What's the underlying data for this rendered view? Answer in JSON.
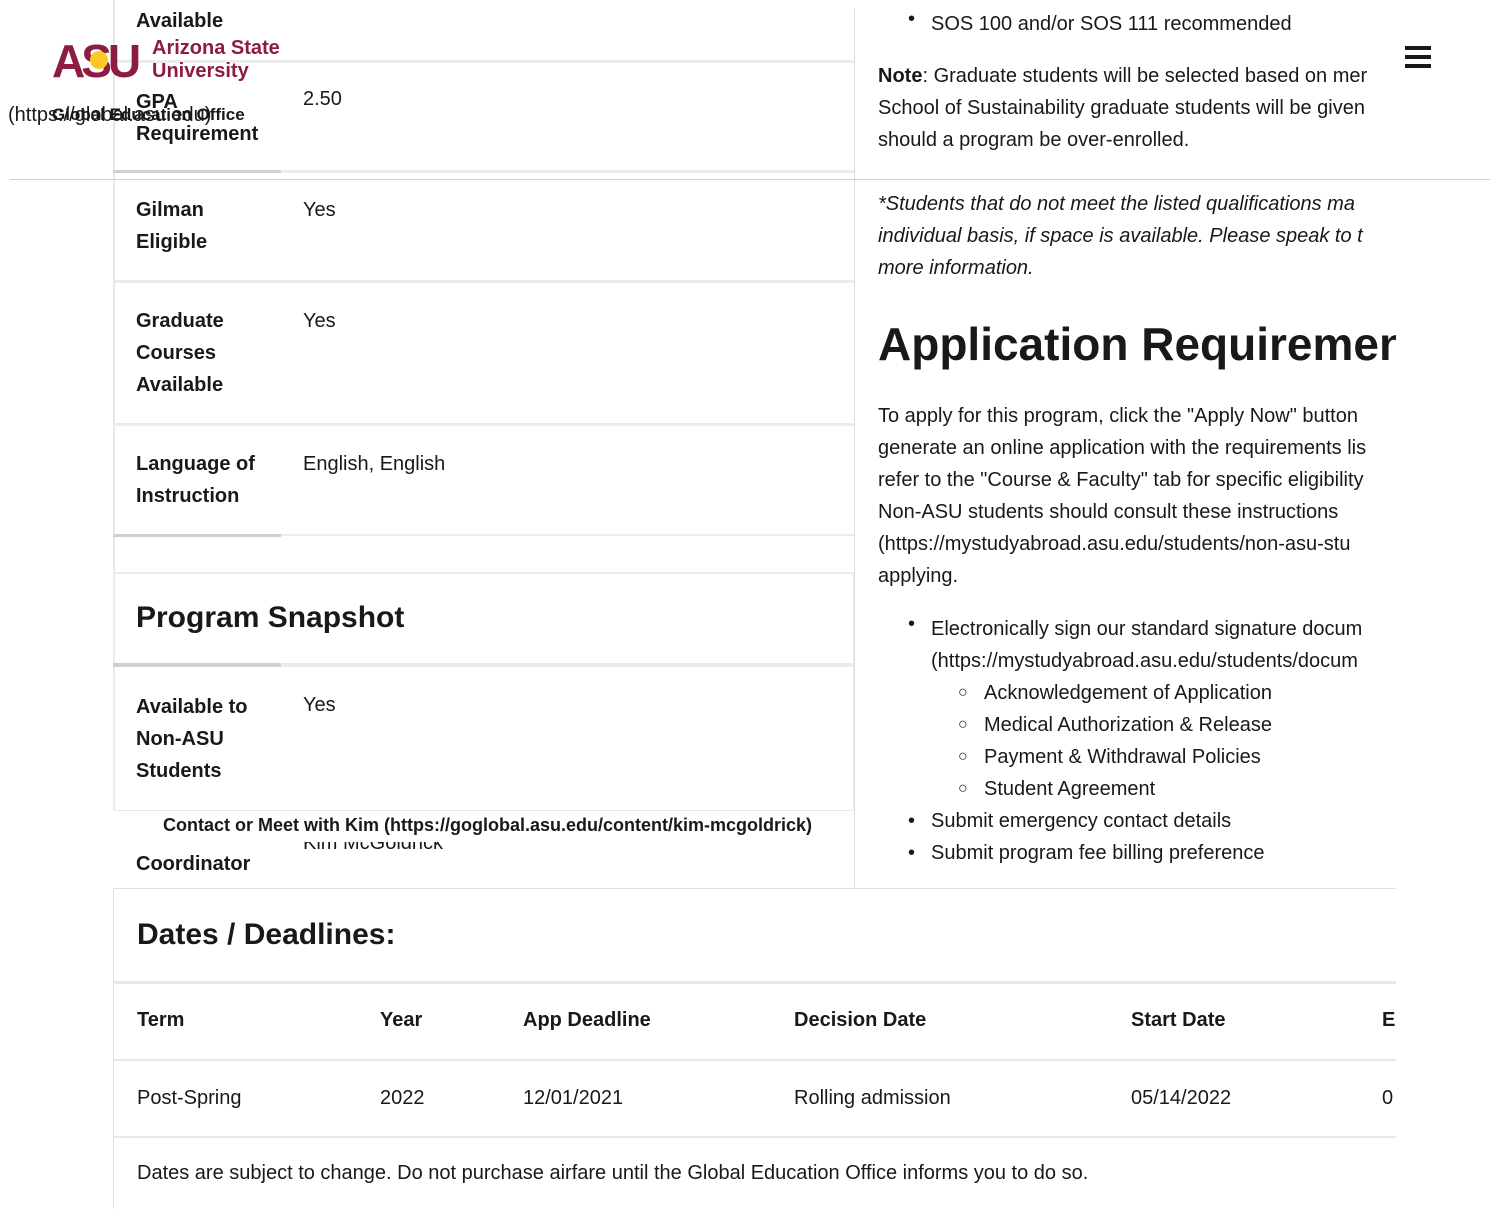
{
  "header": {
    "logo_mark": "ASU",
    "logo_line1": "Arizona State",
    "logo_line2": "University",
    "office_link": "(https://global.asu.edu)",
    "office_name": "Global Education Office",
    "brand_color": "#8c1d40",
    "gold_color": "#ffc627"
  },
  "program_details": {
    "rows": [
      {
        "label": "Available",
        "value": ""
      },
      {
        "label": "GPA Requirement",
        "value": "2.50"
      },
      {
        "label": "Gilman Eligible",
        "value": "Yes"
      },
      {
        "label": "Graduate Courses Available",
        "value": "Yes"
      },
      {
        "label": "Language of Instruction",
        "value": "English, English"
      }
    ]
  },
  "snapshot": {
    "title": "Program Snapshot",
    "rows": [
      {
        "label": "Available to Non-ASU Students",
        "value": "Yes"
      },
      {
        "label": "International Coordinator",
        "value": "Kim McGoldrick"
      }
    ],
    "contact_link": "Contact or Meet with Kim (https://goglobal.asu.edu/content/kim-mcgoldrick)"
  },
  "right_column": {
    "top_bullet": "SOS 100 and/or SOS 111 recommended",
    "note_label": "Note",
    "note_lines": [
      ": Graduate students will be selected based on mer",
      "School of Sustainability graduate students will be given",
      "should a program be over-enrolled."
    ],
    "italic_lines": [
      "*Students that do not meet the listed qualifications ma",
      "individual basis, if space is available.  Please speak to t",
      "more information."
    ],
    "app_req_title": "Application Requiremen",
    "app_req_lines": [
      "To apply for this program, click the \"Apply Now\" button",
      "generate an online application with the requirements lis",
      "refer to the \"Course & Faculty\" tab for specific eligibility",
      "Non-ASU students should consult these instructions",
      "(https://mystudyabroad.asu.edu/students/non-asu-stu",
      "applying."
    ],
    "bullet1_lines": [
      "Electronically sign our standard signature docum",
      "(https://mystudyabroad.asu.edu/students/docum"
    ],
    "sub_bullets": [
      "Acknowledgement of Application",
      "Medical Authorization & Release",
      "Payment & Withdrawal Policies",
      "Student Agreement"
    ],
    "more_bullets": [
      "Submit emergency contact details",
      "Submit program fee billing preference"
    ]
  },
  "dates": {
    "title": "Dates / Deadlines:",
    "columns": [
      "Term",
      "Year",
      "App Deadline",
      "Decision Date",
      "Start Date",
      "E"
    ],
    "rows": [
      [
        "Post-Spring",
        "2022",
        "12/01/2021",
        "Rolling admission",
        "05/14/2022",
        "0"
      ]
    ],
    "footnote": "Dates are subject to change. Do not purchase airfare until the Global Education Office informs you to do so."
  }
}
